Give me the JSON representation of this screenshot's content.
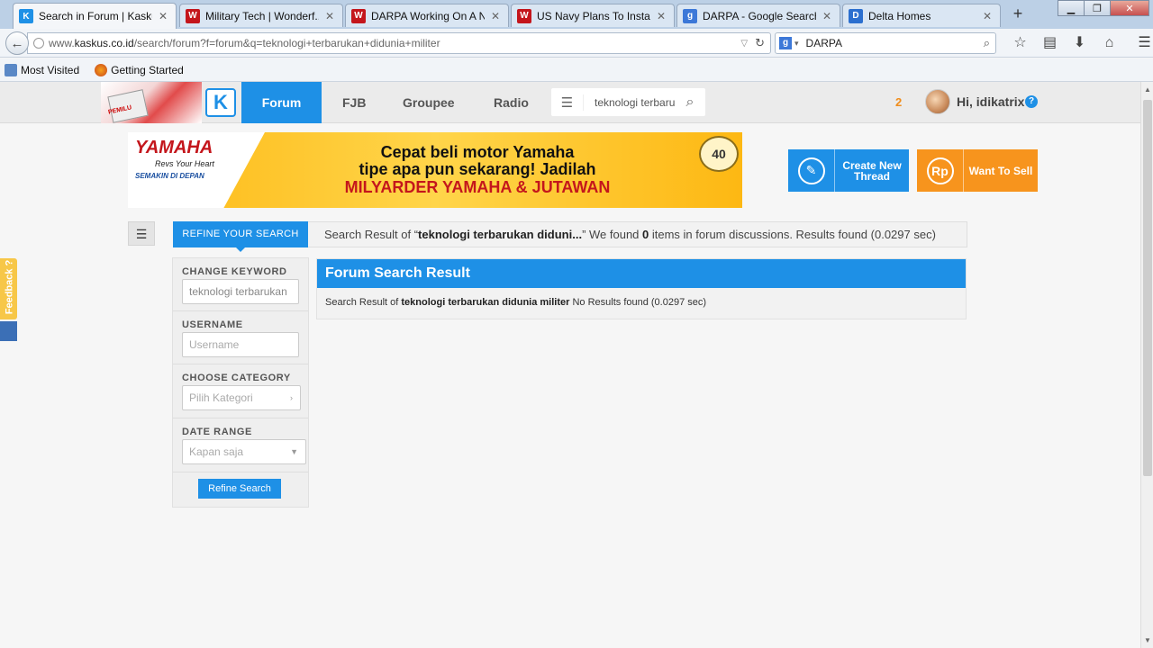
{
  "browser": {
    "tabs": [
      {
        "title": "Search in Forum | Kasku...",
        "favicon": "K",
        "favicon_color": "#1e90e6",
        "active": true
      },
      {
        "title": "Military Tech | Wonderf...",
        "favicon": "W",
        "favicon_color": "#c4161c",
        "active": false
      },
      {
        "title": "DARPA Working On A N...",
        "favicon": "W",
        "favicon_color": "#c4161c",
        "active": false
      },
      {
        "title": "US Navy Plans To Install...",
        "favicon": "W",
        "favicon_color": "#c4161c",
        "active": false
      },
      {
        "title": "DARPA - Google Search",
        "favicon": "g",
        "favicon_color": "#3c78d8",
        "active": false
      },
      {
        "title": "Delta Homes",
        "favicon": "D",
        "favicon_color": "#2b6fcf",
        "active": false
      }
    ],
    "url_prefix": "www.",
    "url_domain": "kaskus.co.id",
    "url_path": "/search/forum?f=forum&q=teknologi+terbarukan+didunia+militer",
    "search_value": "DARPA",
    "bookmarks": [
      {
        "label": "Most Visited"
      },
      {
        "label": "Getting Started"
      }
    ]
  },
  "site": {
    "nav": {
      "forum": "Forum",
      "fjb": "FJB",
      "groupee": "Groupee",
      "radio": "Radio"
    },
    "search_value": "teknologi terbarukan didunia militer",
    "notif_count": "2",
    "greeting": "Hi, idikatrix",
    "help": "?"
  },
  "ad": {
    "brand": "YAMAHA",
    "tagline": "Revs Your Heart",
    "slogan": "SEMAKIN DI DEPAN",
    "line1": "Cepat beli motor Yamaha",
    "line2": "tipe apa pun sekarang! Jadilah",
    "line3": "MILYARDER YAMAHA & JUTAWAN",
    "badge": "40"
  },
  "cta": {
    "create_line1": "Create New",
    "create_line2": "Thread",
    "sell": "Want To Sell",
    "sell_icon": "Rp"
  },
  "search": {
    "refine_tab": "REFINE YOUR SEARCH",
    "summary_prefix": "Search Result of “",
    "summary_query": "teknologi terbarukan diduni...",
    "summary_mid": "” We found ",
    "summary_count": "0",
    "summary_suffix": " items in forum discussions. Results found (0.0297 sec)"
  },
  "sidebar": {
    "keyword_label": "CHANGE KEYWORD",
    "keyword_value": "teknologi terbarukan",
    "username_label": "USERNAME",
    "username_placeholder": "Username",
    "category_label": "CHOOSE CATEGORY",
    "category_value": "Pilih Kategori",
    "date_label": "DATE RANGE",
    "date_value": "Kapan saja",
    "refine_button": "Refine Search"
  },
  "result": {
    "header": "Forum Search Result",
    "prefix": "Search Result of ",
    "query": "teknologi terbarukan didunia militer",
    "suffix": " No Results found (0.0297 sec)"
  },
  "feedback": "Feedback ?"
}
